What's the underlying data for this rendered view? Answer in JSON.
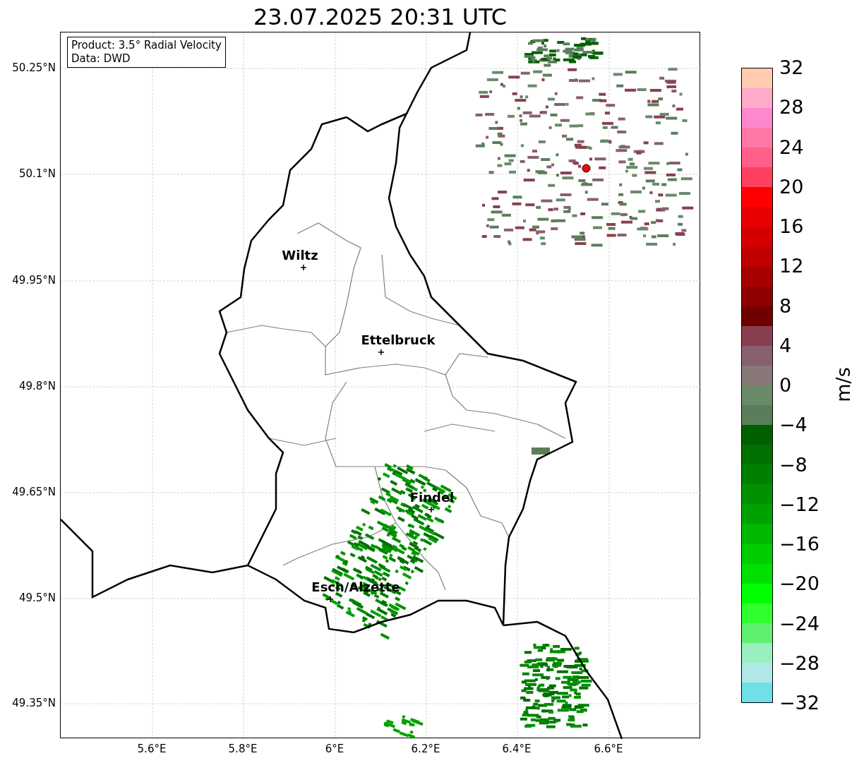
{
  "title": "23.07.2025 20:31 UTC",
  "legend": [
    "Product: 3.5° Radial Velocity",
    "Data: DWD"
  ],
  "y_ticks": [
    "50.25°N",
    "50.1°N",
    "49.95°N",
    "49.8°N",
    "49.65°N",
    "49.5°N",
    "49.35°N"
  ],
  "x_ticks": [
    "5.6°E",
    "5.8°E",
    "6°E",
    "6.2°E",
    "6.4°E",
    "6.6°E"
  ],
  "cities": [
    {
      "name": "Wiltz"
    },
    {
      "name": "Ettelbruck"
    },
    {
      "name": "Findel"
    },
    {
      "name": "Esch/Alzette"
    }
  ],
  "colorbar": {
    "label": "m/s",
    "ticks": [
      "32",
      "28",
      "24",
      "20",
      "16",
      "12",
      "8",
      "4",
      "0",
      "−4",
      "−8",
      "−12",
      "−16",
      "−20",
      "−24",
      "−28",
      "−32"
    ],
    "bands": [
      {
        "color": "#ffccb0"
      },
      {
        "color": "#ffaac8"
      },
      {
        "color": "#ff88cc"
      },
      {
        "color": "#ff78a8"
      },
      {
        "color": "#ff6088"
      },
      {
        "color": "#ff4060"
      },
      {
        "color": "#ff0000"
      },
      {
        "color": "#e80000"
      },
      {
        "color": "#d40000"
      },
      {
        "color": "#c00000"
      },
      {
        "color": "#a80000"
      },
      {
        "color": "#900000"
      },
      {
        "color": "#700000"
      },
      {
        "color": "#884050"
      },
      {
        "color": "#886070"
      },
      {
        "color": "#887878"
      },
      {
        "color": "#6a8a6a"
      },
      {
        "color": "#5a7e5a"
      },
      {
        "color": "#006000"
      },
      {
        "color": "#007000"
      },
      {
        "color": "#008000"
      },
      {
        "color": "#009000"
      },
      {
        "color": "#00a000"
      },
      {
        "color": "#00b800"
      },
      {
        "color": "#00cc00"
      },
      {
        "color": "#00e000"
      },
      {
        "color": "#00ff00"
      },
      {
        "color": "#30ff30"
      },
      {
        "color": "#60f070"
      },
      {
        "color": "#98f0c0"
      },
      {
        "color": "#b0e8e8"
      },
      {
        "color": "#70e0e8"
      }
    ]
  }
}
